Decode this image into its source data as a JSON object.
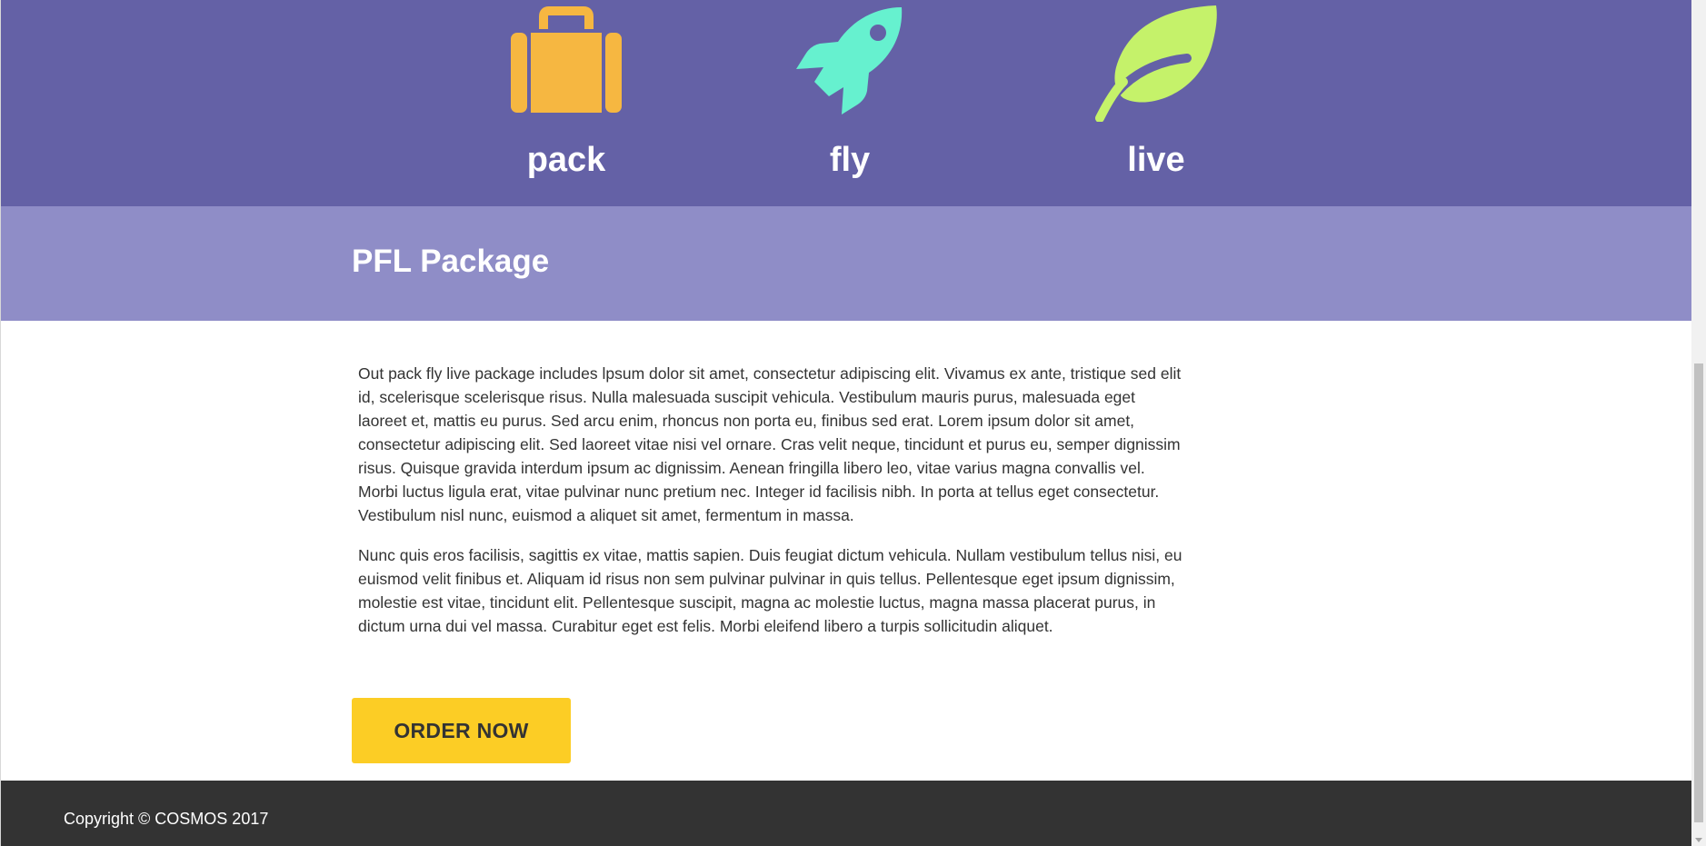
{
  "colors": {
    "hero_bg": "#6461a6",
    "title_band_bg": "#8f8dc7",
    "button_bg": "#fccd25",
    "footer_bg": "#333333",
    "pack_icon": "#f6b741",
    "fly_icon": "#66f1cf",
    "live_icon": "#c5f26a"
  },
  "features": [
    {
      "label": "pack",
      "icon": "luggage-icon"
    },
    {
      "label": "fly",
      "icon": "rocket-icon"
    },
    {
      "label": "live",
      "icon": "leaf-icon"
    }
  ],
  "package": {
    "title": "PFL Package",
    "paragraphs": [
      "Out pack fly live package includes lpsum dolor sit amet, consectetur adipiscing elit. Vivamus ex ante, tristique sed elit id, scelerisque scelerisque risus. Nulla malesuada suscipit vehicula. Vestibulum mauris purus, malesuada eget laoreet et, mattis eu purus. Sed arcu enim, rhoncus non porta eu, finibus sed erat. Lorem ipsum dolor sit amet, consectetur adipiscing elit. Sed laoreet vitae nisi vel ornare. Cras velit neque, tincidunt et purus eu, semper dignissim risus. Quisque gravida interdum ipsum ac dignissim. Aenean fringilla libero leo, vitae varius magna convallis vel. Morbi luctus ligula erat, vitae pulvinar nunc pretium nec. Integer id facilisis nibh. In porta at tellus eget consectetur. Vestibulum nisl nunc, euismod a aliquet sit amet, fermentum in massa.",
      "Nunc quis eros facilisis, sagittis ex vitae, mattis sapien. Duis feugiat dictum vehicula. Nullam vestibulum tellus nisi, eu euismod velit finibus et. Aliquam id risus non sem pulvinar pulvinar in quis tellus. Pellentesque eget ipsum dignissim, molestie est vitae, tincidunt elit. Pellentesque suscipit, magna ac molestie luctus, magna massa placerat purus, in dictum urna dui vel massa. Curabitur eget est felis. Morbi eleifend libero a turpis sollicitudin aliquet."
    ],
    "button_label": "ORDER NOW"
  },
  "footer": {
    "copyright": "Copyright © COSMOS 2017"
  }
}
